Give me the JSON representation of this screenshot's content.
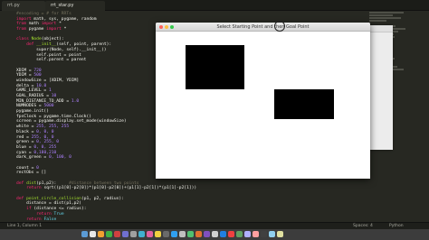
{
  "tabs": [
    {
      "label": "rrt.py"
    },
    {
      "label": "rrt_star.py"
    }
  ],
  "code": [
    {
      "seg": [
        [
          "cm",
          "#encoding = # for RRTs"
        ]
      ]
    },
    {
      "seg": [
        [
          "kw",
          "import"
        ],
        [
          "",
          " math, sys, pygame, random"
        ]
      ]
    },
    {
      "seg": [
        [
          "kw",
          "from"
        ],
        [
          "",
          " math "
        ],
        [
          "kw",
          "import"
        ],
        [
          "",
          " *"
        ]
      ]
    },
    {
      "seg": [
        [
          "kw",
          "from"
        ],
        [
          "",
          " pygame "
        ],
        [
          "kw",
          "import"
        ],
        [
          "",
          " *"
        ]
      ]
    },
    {
      "seg": [
        [
          "",
          ""
        ]
      ]
    },
    {
      "seg": [
        [
          "kw",
          "class"
        ],
        [
          "fn",
          " Node"
        ],
        [
          "",
          "(object):"
        ]
      ]
    },
    {
      "seg": [
        [
          "",
          "    "
        ],
        [
          "kw",
          "def"
        ],
        [
          "fn",
          " __init__"
        ],
        [
          "",
          "(self, point, parent):"
        ]
      ]
    },
    {
      "seg": [
        [
          "",
          "        super(Node, self).__init__()"
        ]
      ]
    },
    {
      "seg": [
        [
          "",
          "        self.point = point"
        ]
      ]
    },
    {
      "seg": [
        [
          "",
          "        self.parent = parent"
        ]
      ]
    },
    {
      "seg": [
        [
          "",
          ""
        ]
      ]
    },
    {
      "seg": [
        [
          "",
          "XDIM = "
        ],
        [
          "num",
          "720"
        ]
      ]
    },
    {
      "seg": [
        [
          "",
          "YDIM = "
        ],
        [
          "num",
          "500"
        ]
      ]
    },
    {
      "seg": [
        [
          "",
          "windowSize = [XDIM, YDIM]"
        ]
      ]
    },
    {
      "seg": [
        [
          "",
          "delta = "
        ],
        [
          "num",
          "10.0"
        ]
      ]
    },
    {
      "seg": [
        [
          "",
          "GAME_LEVEL = "
        ],
        [
          "num",
          "1"
        ]
      ]
    },
    {
      "seg": [
        [
          "",
          "GOAL_RADIUS = "
        ],
        [
          "num",
          "10"
        ]
      ]
    },
    {
      "seg": [
        [
          "",
          "MIN_DISTANCE_TO_ADD = "
        ],
        [
          "num",
          "1.0"
        ]
      ]
    },
    {
      "seg": [
        [
          "",
          "NUMNODES = "
        ],
        [
          "num",
          "5000"
        ]
      ]
    },
    {
      "seg": [
        [
          "",
          "pygame.init()"
        ]
      ]
    },
    {
      "seg": [
        [
          "",
          "fpsClock = pygame.time.Clock()"
        ]
      ]
    },
    {
      "seg": [
        [
          "",
          "screen = pygame.display.set_mode(windowSize)"
        ]
      ]
    },
    {
      "seg": [
        [
          "",
          "white = "
        ],
        [
          "num",
          "255, 255, 255"
        ]
      ]
    },
    {
      "seg": [
        [
          "",
          "black = "
        ],
        [
          "num",
          "0, 0, 0"
        ]
      ]
    },
    {
      "seg": [
        [
          "",
          "red = "
        ],
        [
          "num",
          "255, 0, 0"
        ]
      ]
    },
    {
      "seg": [
        [
          "",
          "green = "
        ],
        [
          "num",
          "0, 255, 0"
        ]
      ]
    },
    {
      "seg": [
        [
          "",
          "blue = "
        ],
        [
          "num",
          "0, 0, 255"
        ]
      ]
    },
    {
      "seg": [
        [
          "",
          "cyan = "
        ],
        [
          "num",
          "0,180,210"
        ]
      ]
    },
    {
      "seg": [
        [
          "",
          "dark_green = "
        ],
        [
          "num",
          "0, 100, 0"
        ]
      ]
    },
    {
      "seg": [
        [
          "",
          ""
        ]
      ]
    },
    {
      "seg": [
        [
          "",
          "count = "
        ],
        [
          "num",
          "0"
        ]
      ]
    },
    {
      "seg": [
        [
          "",
          "rectObs = []"
        ]
      ]
    },
    {
      "seg": [
        [
          "",
          ""
        ]
      ]
    },
    {
      "seg": [
        [
          "kw",
          "def"
        ],
        [
          "fn",
          " dist"
        ],
        [
          "",
          "(p1,p2):     "
        ],
        [
          "cm",
          "#distance between two points"
        ]
      ]
    },
    {
      "seg": [
        [
          "",
          "    "
        ],
        [
          "kw",
          "return"
        ],
        [
          "",
          " sqrt((p1[0]-p2[0])*(p1[0]-p2[0])+(p1[1]-p2[1])*(p1[1]-p2[1]))"
        ]
      ]
    },
    {
      "seg": [
        [
          "",
          ""
        ]
      ]
    },
    {
      "seg": [
        [
          "kw",
          "def"
        ],
        [
          "fn",
          " point_circle_collision"
        ],
        [
          "",
          "(p1, p2, radius):"
        ]
      ]
    },
    {
      "seg": [
        [
          "",
          "    distance = dist(p1,p2)"
        ]
      ]
    },
    {
      "seg": [
        [
          "",
          "    "
        ],
        [
          "kw",
          "if"
        ],
        [
          "",
          " (distance <= radius):"
        ]
      ]
    },
    {
      "seg": [
        [
          "",
          "        "
        ],
        [
          "kw",
          "return"
        ],
        [
          "bi",
          " True"
        ]
      ]
    },
    {
      "seg": [
        [
          "",
          "    "
        ],
        [
          "kw",
          "return"
        ],
        [
          "bi",
          " False"
        ]
      ]
    }
  ],
  "statusbar": {
    "position": "Line 1, Column 1",
    "spaces": "Spaces: 4",
    "syntax": "Python"
  },
  "pygame_window": {
    "title": "Select Starting Point and then Goal Point"
  },
  "colors": {
    "editor_bg": "#272822",
    "keyword": "#f92672",
    "function": "#a6e22e",
    "number": "#ae81ff",
    "comment": "#75715e",
    "obstacle": "#000000"
  }
}
